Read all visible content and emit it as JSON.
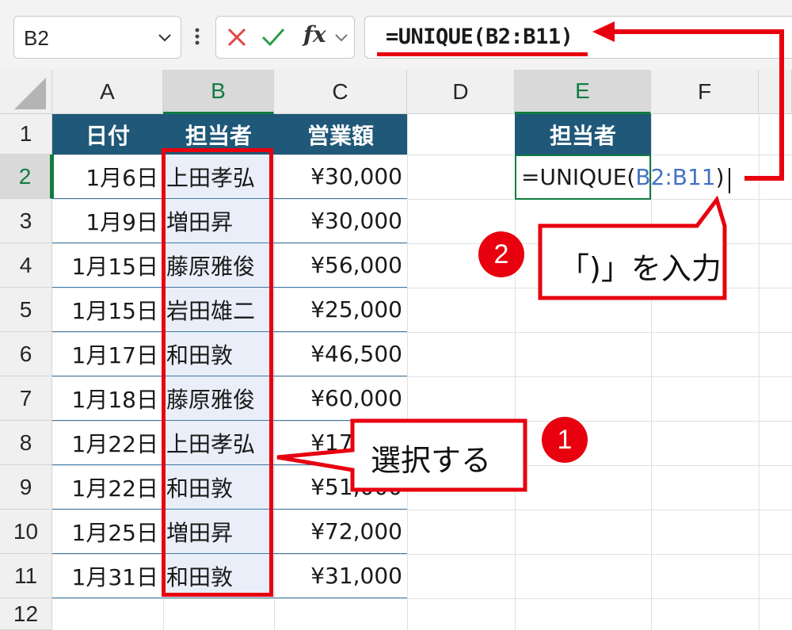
{
  "formula_bar": {
    "name_box": "B2",
    "cancel_icon": "x-icon",
    "enter_icon": "check-icon",
    "fx_label": "fx",
    "formula": "=UNIQUE(B2:B11)"
  },
  "columns": [
    "A",
    "B",
    "C",
    "D",
    "E",
    "F"
  ],
  "rows": [
    "1",
    "2",
    "3",
    "4",
    "5",
    "6",
    "7",
    "8",
    "9",
    "10",
    "11",
    "12"
  ],
  "table": {
    "headers": [
      "日付",
      "担当者",
      "営業額"
    ],
    "rows": [
      [
        "1月6日",
        "上田孝弘",
        "¥30,000"
      ],
      [
        "1月9日",
        "増田昇",
        "¥30,000"
      ],
      [
        "1月15日",
        "藤原雅俊",
        "¥56,000"
      ],
      [
        "1月15日",
        "岩田雄二",
        "¥25,000"
      ],
      [
        "1月17日",
        "和田敦",
        "¥46,500"
      ],
      [
        "1月18日",
        "藤原雅俊",
        "¥60,000"
      ],
      [
        "1月22日",
        "上田孝弘",
        "¥17,000"
      ],
      [
        "1月22日",
        "和田敦",
        "¥51,000"
      ],
      [
        "1月25日",
        "増田昇",
        "¥72,000"
      ],
      [
        "1月31日",
        "和田敦",
        "¥31,000"
      ]
    ]
  },
  "result": {
    "header": "担当者",
    "edit_prefix": "=UNIQUE(",
    "edit_ref": "B2:B11",
    "edit_suffix": ")"
  },
  "annotations": {
    "step1_number": "1",
    "step1_text": "選択する",
    "step2_number": "2",
    "step2_text": "「)」を入力"
  },
  "colors": {
    "accent_red": "#e8000f",
    "header_fill": "#1f5878",
    "excel_green": "#107c41",
    "ref_blue": "#4472c4"
  }
}
